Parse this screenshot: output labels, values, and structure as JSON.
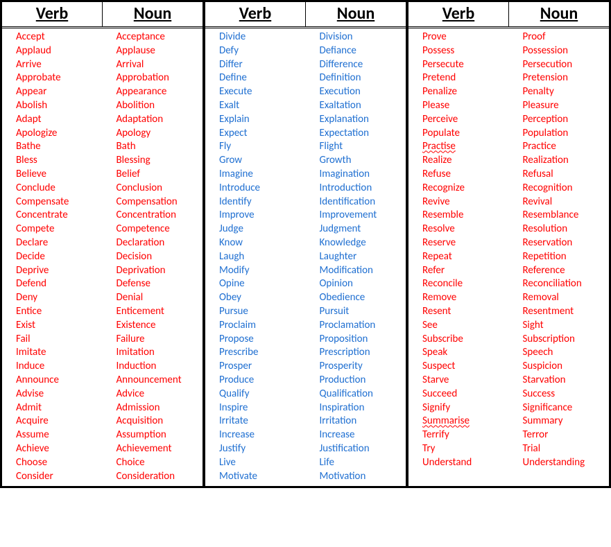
{
  "headers": {
    "verb": "Verb",
    "noun": "Noun"
  },
  "columns": [
    {
      "class": "col-a",
      "rows": [
        {
          "verb": "Accept",
          "noun": "Acceptance"
        },
        {
          "verb": "Applaud",
          "noun": "Applause"
        },
        {
          "verb": "Arrive",
          "noun": "Arrival"
        },
        {
          "verb": "Approbate",
          "noun": "Approbation"
        },
        {
          "verb": "Appear",
          "noun": "Appearance"
        },
        {
          "verb": "Abolish",
          "noun": "Abolition"
        },
        {
          "verb": "Adapt",
          "noun": "Adaptation"
        },
        {
          "verb": "Apologize",
          "noun": "Apology"
        },
        {
          "verb": "Bathe",
          "noun": "Bath"
        },
        {
          "verb": "Bless",
          "noun": "Blessing"
        },
        {
          "verb": "Believe",
          "noun": "Belief"
        },
        {
          "verb": "Conclude",
          "noun": "Conclusion"
        },
        {
          "verb": "Compensate",
          "noun": "Compensation"
        },
        {
          "verb": "Concentrate",
          "noun": "Concentration"
        },
        {
          "verb": "Compete",
          "noun": "Competence"
        },
        {
          "verb": "Declare",
          "noun": "Declaration"
        },
        {
          "verb": "Decide",
          "noun": "Decision"
        },
        {
          "verb": "Deprive",
          "noun": "Deprivation"
        },
        {
          "verb": "Defend",
          "noun": "Defense"
        },
        {
          "verb": "Deny",
          "noun": "Denial"
        },
        {
          "verb": "Entice",
          "noun": "Enticement"
        },
        {
          "verb": "Exist",
          "noun": "Existence"
        },
        {
          "verb": "Fail",
          "noun": "Failure"
        },
        {
          "verb": "Imitate",
          "noun": "Imitation"
        },
        {
          "verb": "Induce",
          "noun": "Induction"
        },
        {
          "verb": "Announce",
          "noun": "Announcement"
        },
        {
          "verb": "Advise",
          "noun": "Advice"
        },
        {
          "verb": "Admit",
          "noun": "Admission"
        },
        {
          "verb": "Acquire",
          "noun": "Acquisition"
        },
        {
          "verb": "Assume",
          "noun": "Assumption"
        },
        {
          "verb": "Achieve",
          "noun": "Achievement"
        },
        {
          "verb": "Choose",
          "noun": "Choice"
        },
        {
          "verb": "Consider",
          "noun": "Consideration"
        }
      ]
    },
    {
      "class": "col-b",
      "rows": [
        {
          "verb": "Divide",
          "noun": "Division"
        },
        {
          "verb": "Defy",
          "noun": "Defiance"
        },
        {
          "verb": "Differ",
          "noun": "Difference"
        },
        {
          "verb": "Define",
          "noun": "Definition"
        },
        {
          "verb": "Execute",
          "noun": "Execution"
        },
        {
          "verb": "Exalt",
          "noun": "Exaltation"
        },
        {
          "verb": "Explain",
          "noun": "Explanation"
        },
        {
          "verb": "Expect",
          "noun": "Expectation"
        },
        {
          "verb": "Fly",
          "noun": "Flight"
        },
        {
          "verb": "Grow",
          "noun": "Growth"
        },
        {
          "verb": "Imagine",
          "noun": "Imagination"
        },
        {
          "verb": "Introduce",
          "noun": "Introduction"
        },
        {
          "verb": "Identify",
          "noun": "Identification"
        },
        {
          "verb": "Improve",
          "noun": "Improvement"
        },
        {
          "verb": "Judge",
          "noun": "Judgment"
        },
        {
          "verb": "Know",
          "noun": "Knowledge"
        },
        {
          "verb": "Laugh",
          "noun": "Laughter"
        },
        {
          "verb": "Modify",
          "noun": "Modification"
        },
        {
          "verb": "Opine",
          "noun": "Opinion"
        },
        {
          "verb": "Obey",
          "noun": "Obedience"
        },
        {
          "verb": "Pursue",
          "noun": "Pursuit"
        },
        {
          "verb": "Proclaim",
          "noun": "Proclamation"
        },
        {
          "verb": "Propose",
          "noun": "Proposition"
        },
        {
          "verb": "Prescribe",
          "noun": "Prescription"
        },
        {
          "verb": "Prosper",
          "noun": "Prosperity"
        },
        {
          "verb": "Produce",
          "noun": "Production"
        },
        {
          "verb": "Qualify",
          "noun": "Qualification"
        },
        {
          "verb": "Inspire",
          "noun": "Inspiration"
        },
        {
          "verb": "Irritate",
          "noun": "Irritation"
        },
        {
          "verb": "Increase",
          "noun": "Increase"
        },
        {
          "verb": "Justify",
          "noun": "Justification"
        },
        {
          "verb": "Live",
          "noun": "Life"
        },
        {
          "verb": "Motivate",
          "noun": "Motivation"
        }
      ]
    },
    {
      "class": "col-c",
      "rows": [
        {
          "verb": "Prove",
          "noun": "Proof"
        },
        {
          "verb": "Possess",
          "noun": "Possession"
        },
        {
          "verb": "Persecute",
          "noun": "Persecution"
        },
        {
          "verb": "Pretend",
          "noun": "Pretension"
        },
        {
          "verb": "Penalize",
          "noun": "Penalty"
        },
        {
          "verb": "Please",
          "noun": "Pleasure"
        },
        {
          "verb": "Perceive",
          "noun": "Perception"
        },
        {
          "verb": "Populate",
          "noun": "Population"
        },
        {
          "verb": "Practise",
          "verb_squiggle": true,
          "noun": "Practice"
        },
        {
          "verb": "Realize",
          "noun": "Realization"
        },
        {
          "verb": "Refuse",
          "noun": "Refusal"
        },
        {
          "verb": "Recognize",
          "noun": "Recognition"
        },
        {
          "verb": "Revive",
          "noun": "Revival"
        },
        {
          "verb": "Resemble",
          "noun": "Resemblance"
        },
        {
          "verb": "Resolve",
          "noun": "Resolution"
        },
        {
          "verb": "Reserve",
          "noun": "Reservation"
        },
        {
          "verb": "Repeat",
          "noun": "Repetition"
        },
        {
          "verb": "Refer",
          "noun": "Reference"
        },
        {
          "verb": "Reconcile",
          "noun": "Reconciliation"
        },
        {
          "verb": "Remove",
          "noun": "Removal"
        },
        {
          "verb": "Resent",
          "noun": "Resentment"
        },
        {
          "verb": "See",
          "noun": "Sight"
        },
        {
          "verb": "Subscribe",
          "noun": "Subscription"
        },
        {
          "verb": "Speak",
          "noun": "Speech"
        },
        {
          "verb": "Suspect",
          "noun": "Suspicion"
        },
        {
          "verb": "Starve",
          "noun": "Starvation"
        },
        {
          "verb": "Succeed",
          "noun": "Success"
        },
        {
          "verb": "Signify",
          "noun": "Significance"
        },
        {
          "verb": "Summarise",
          "verb_squiggle": true,
          "noun": "Summary"
        },
        {
          "verb": "Terrify",
          "noun": "Terror"
        },
        {
          "verb": "Try",
          "noun": "Trial"
        },
        {
          "verb": "Understand",
          "noun": "Understanding"
        }
      ]
    }
  ]
}
